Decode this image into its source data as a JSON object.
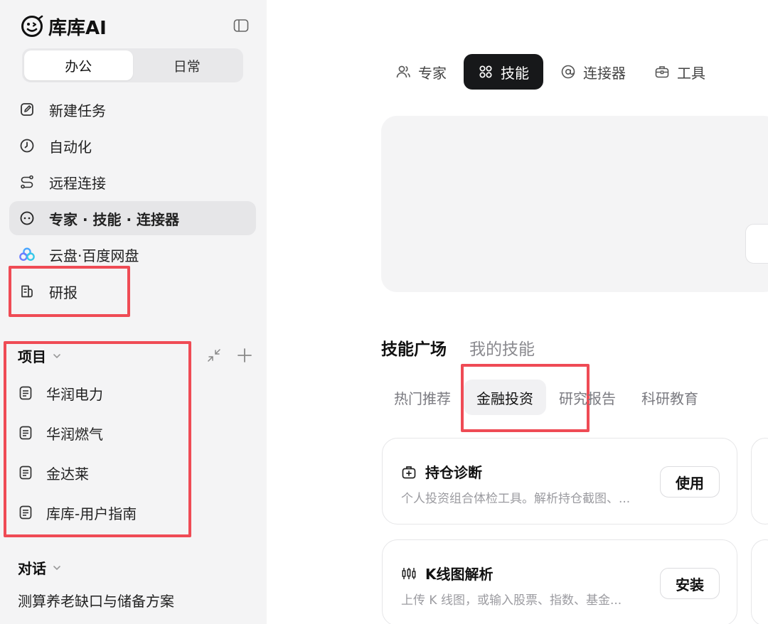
{
  "app": {
    "name": "库库AI"
  },
  "mode_switch": {
    "options": [
      "办公",
      "日常"
    ],
    "selected": "办公"
  },
  "nav": [
    {
      "label": "新建任务",
      "icon": "edit-icon"
    },
    {
      "label": "自动化",
      "icon": "clock-icon"
    },
    {
      "label": "远程连接",
      "icon": "route-icon"
    },
    {
      "label": "专家 · 技能 · 连接器",
      "icon": "smile-circle-icon",
      "active": true
    },
    {
      "label": "云盘·百度网盘",
      "icon": "baidu-netdisk-icon"
    },
    {
      "label": "研报",
      "icon": "report-icon"
    }
  ],
  "projects": {
    "title": "项目",
    "items": [
      "华润电力",
      "华润燃气",
      "金达莱",
      "库库-用户指南"
    ]
  },
  "chats": {
    "title": "对话",
    "items": [
      "测算养老缺口与储备方案"
    ]
  },
  "top_tabs": [
    {
      "label": "专家",
      "icon": "users-icon"
    },
    {
      "label": "技能",
      "icon": "grid-icon",
      "active": true
    },
    {
      "label": "连接器",
      "icon": "at-icon"
    },
    {
      "label": "工具",
      "icon": "toolbox-icon"
    }
  ],
  "skill_tabs": {
    "items": [
      "技能广场",
      "我的技能"
    ],
    "active": "技能广场"
  },
  "categories": {
    "items": [
      "热门推荐",
      "金融投资",
      "研究报告",
      "科研教育"
    ],
    "active": "金融投资"
  },
  "cards": [
    {
      "title": "持仓诊断",
      "desc": "个人投资组合体检工具。解析持仓截图、...",
      "button": "使用",
      "icon": "briefcase-plus-icon"
    },
    {
      "title": "K线图解析",
      "desc": "上传 K 线图，或输入股票、指数、基金...",
      "button": "安装",
      "icon": "candlestick-icon"
    }
  ],
  "colors": {
    "highlight": "#ef4b55",
    "active_tab_bg": "#17181a",
    "sidebar_bg": "#f4f4f5"
  }
}
